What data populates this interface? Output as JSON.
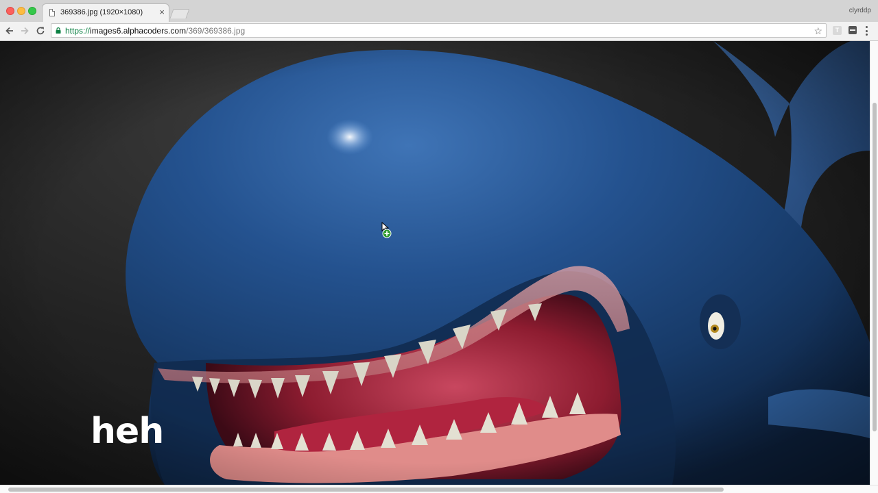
{
  "window": {
    "profile_name": "clyrddp"
  },
  "tab": {
    "title": "369386.jpg (1920×1080)",
    "close_label": "×",
    "icon": "document-icon"
  },
  "toolbar": {
    "url_scheme": "https://",
    "url_host": "images6.alphacoders.com",
    "url_path": "/369/369386.jpg",
    "bookmark_star": "☆",
    "extension_label": "T"
  },
  "content": {
    "image_subject": "cartoon blue whale with open mouth",
    "caption": "heh"
  },
  "colors": {
    "whale_blue": "#1f4a86",
    "mouth_red": "#9a1e33",
    "tongue_pink": "#c0394e",
    "background": "#1b1b1b"
  }
}
